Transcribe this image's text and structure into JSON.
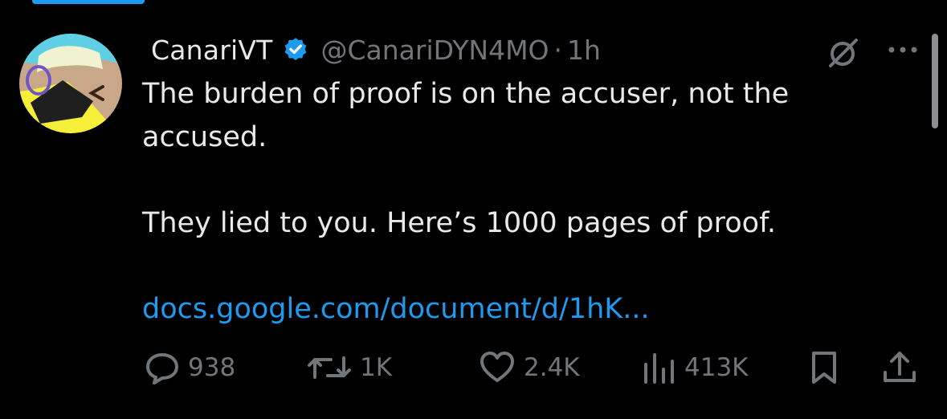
{
  "tweet": {
    "author_name": "CanariVT",
    "handle": "@CanariDYN4MO",
    "separator": "·",
    "time": "1h",
    "text_line1": "The burden of proof is on the accuser, not the",
    "text_line2": "accused.",
    "text_para2": "They lied to you. Here’s 1000 pages of proof.",
    "link_text": "docs.google.com/document/d/1hK..."
  },
  "actions": {
    "replies": "938",
    "reposts": "1K",
    "likes": "2.4K",
    "views": "413K"
  },
  "icons": {
    "verified": "verified-badge-icon",
    "grok": "grok-icon",
    "more": "more-icon",
    "reply": "reply-icon",
    "repost": "repost-icon",
    "like": "like-icon",
    "views": "views-icon",
    "bookmark": "bookmark-icon",
    "share": "share-icon"
  },
  "colors": {
    "background": "#000000",
    "text": "#e7e9ea",
    "muted": "#71767b",
    "accent": "#1d9bf0"
  }
}
